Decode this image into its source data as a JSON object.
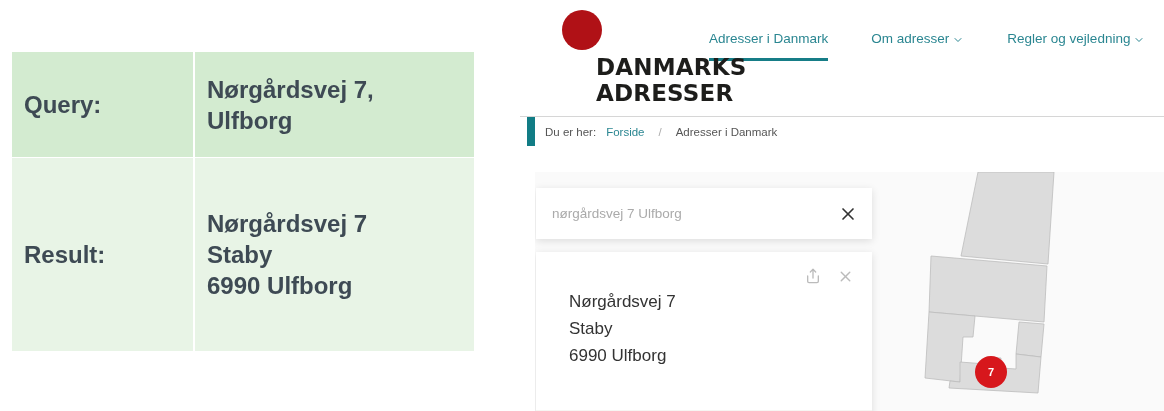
{
  "comparison": {
    "rows": [
      {
        "label": "Query:",
        "value_lines": [
          "Nørgårdsvej 7,",
          "Ulfborg"
        ],
        "kind": "header"
      },
      {
        "label": "Result:",
        "value_lines": [
          "Nørgårdsvej 7",
          "Staby",
          "6990 Ulfborg"
        ],
        "kind": "body"
      }
    ]
  },
  "site": {
    "logo": {
      "lines": [
        "DANMARKS",
        "ADRESSER"
      ]
    },
    "nav": [
      {
        "label": "Adresser i Danmark",
        "selected": true,
        "dropdown": false
      },
      {
        "label": "Om adresser",
        "selected": false,
        "dropdown": true
      },
      {
        "label": "Regler og vejledning",
        "selected": false,
        "dropdown": true
      }
    ],
    "breadcrumb": {
      "prefix": "Du er her:",
      "separator": "/",
      "items": [
        {
          "label": "Forside",
          "kind": "link"
        },
        {
          "label": "Adresser i Danmark",
          "kind": "current"
        }
      ]
    },
    "search": {
      "value": "nørgårdsvej 7 Ulfborg"
    },
    "result_card": {
      "lines": [
        "Nørgårdsvej 7",
        "Staby",
        "6990 Ulfborg"
      ]
    },
    "map": {
      "marker": "7"
    }
  }
}
